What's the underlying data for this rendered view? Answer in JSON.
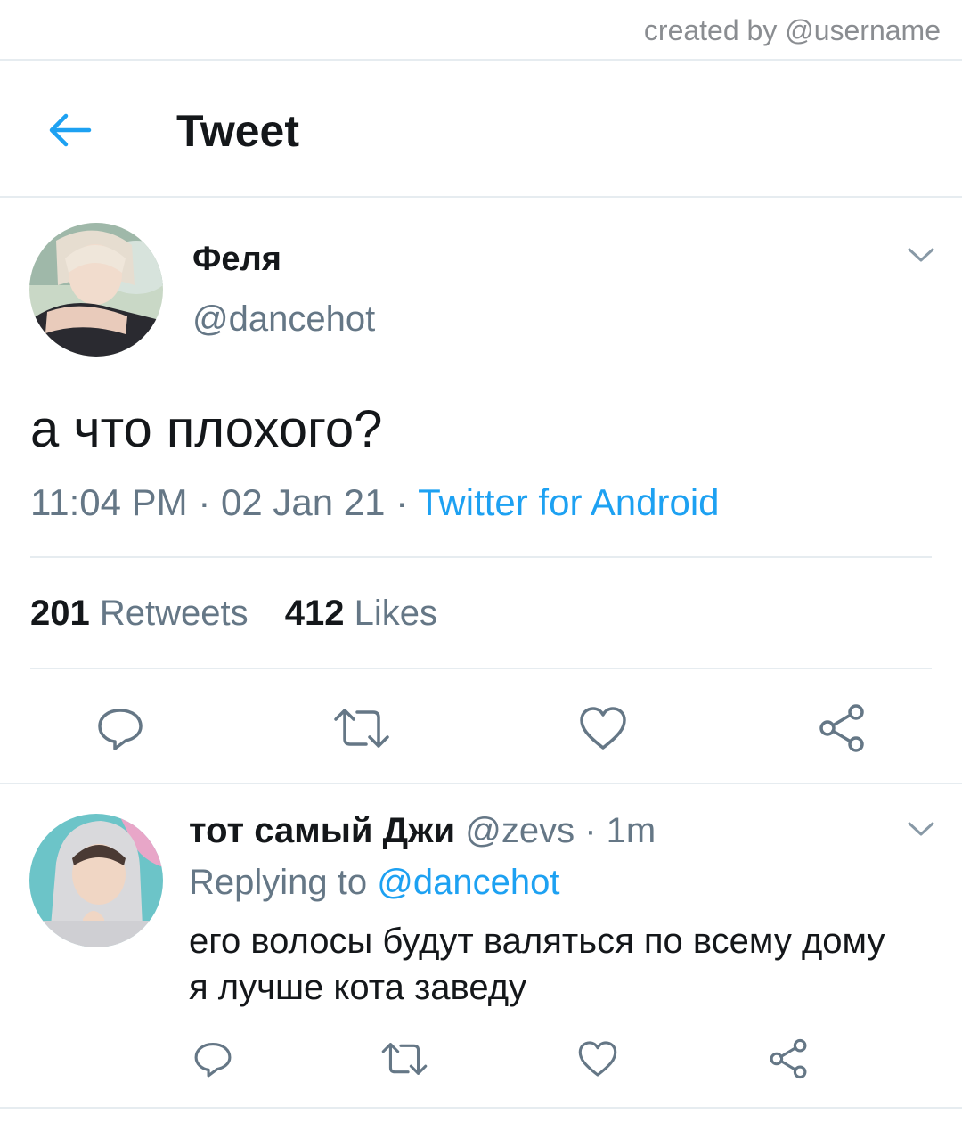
{
  "credit": {
    "text": "created by @username"
  },
  "header": {
    "title": "Tweet",
    "back_icon": "arrow-left-icon"
  },
  "tweet": {
    "name": "Феля",
    "handle": "@dancehot",
    "text": "а что плохого?",
    "time": "11:04 PM",
    "date": "02 Jan 21",
    "source": "Twitter for Android",
    "retweets_count": "201",
    "retweets_label": "Retweets",
    "likes_count": "412",
    "likes_label": "Likes"
  },
  "reply": {
    "name": "тот самый Джи",
    "handle": "@zevs",
    "time": "1m",
    "replying_label": "Replying to",
    "replying_to": "@dancehot",
    "text_line1": "его волосы будут валяться по всему дому",
    "text_line2": "я лучше кота заведу"
  },
  "colors": {
    "accent": "#1da1f2",
    "muted": "#657786",
    "text": "#14171a",
    "divider": "#e6ecf0"
  },
  "icons": [
    "arrow-left-icon",
    "chevron-down-icon",
    "reply-icon",
    "retweet-icon",
    "like-icon",
    "share-icon"
  ]
}
